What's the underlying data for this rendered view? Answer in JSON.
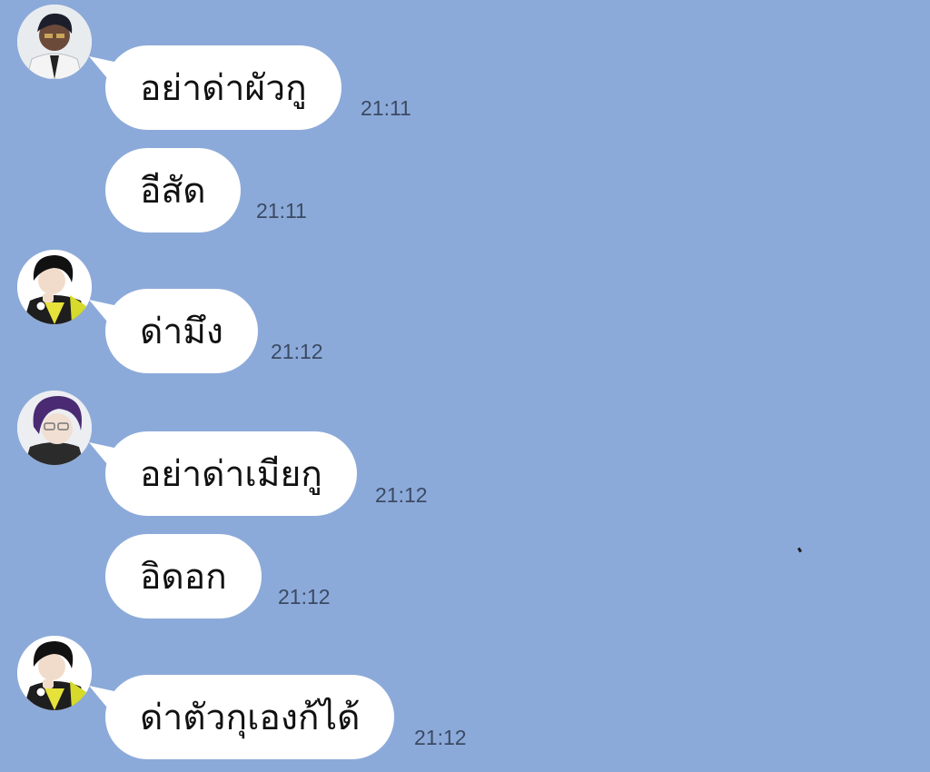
{
  "chat": {
    "background_color": "#8caad9",
    "messages": [
      {
        "avatar": "avatar-white-coat-person",
        "text": "อย่าด่าผัวกู",
        "time": "21:11"
      },
      {
        "text": "อีสัด",
        "time": "21:11"
      },
      {
        "avatar": "avatar-dark-hair-yellow-jacket",
        "text": "ด่ามึง",
        "time": "21:12"
      },
      {
        "avatar": "avatar-purple-hair-glasses",
        "text": "อย่าด่าเมียกู",
        "time": "21:12"
      },
      {
        "text": "อิดอก",
        "time": "21:12"
      },
      {
        "avatar": "avatar-dark-hair-yellow-jacket",
        "text": "ด่าตัวกุเองก้ได้",
        "time": "21:12"
      }
    ]
  }
}
